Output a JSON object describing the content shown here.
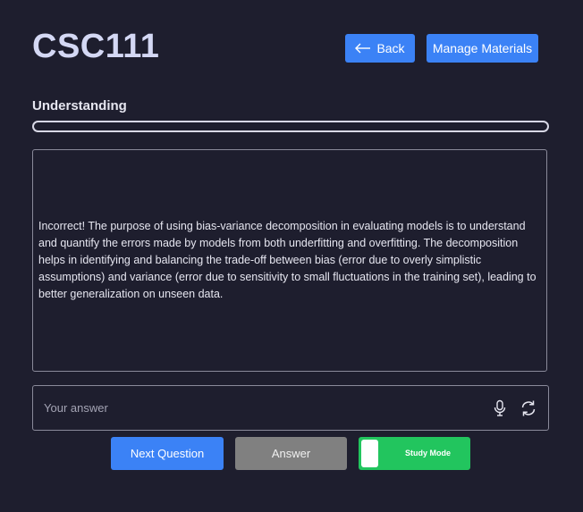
{
  "header": {
    "course_title": "CSC111",
    "back_label": "Back",
    "manage_label": "Manage Materials"
  },
  "section": {
    "label": "Understanding",
    "progress": 0
  },
  "feedback": {
    "text": "Incorrect! The purpose of using bias-variance decomposition in evaluating models is to understand and quantify the errors made by models from both underfitting and overfitting. The decomposition helps in identifying and balancing the trade-off between bias (error due to overly simplistic assumptions) and variance (error due to sensitivity to small fluctuations in the training set), leading to better generalization on unseen data."
  },
  "answer": {
    "placeholder": "Your answer",
    "value": "",
    "icons": [
      "microphone-icon",
      "refresh-icon"
    ]
  },
  "actions": {
    "next_label": "Next Question",
    "answer_label": "Answer",
    "study_mode_label": "Study Mode",
    "study_mode_on": true
  },
  "colors": {
    "background": "#1e1e2e",
    "accent_blue": "#3b82f6",
    "toggle_green": "#22c55e",
    "answer_gray": "#808080"
  }
}
